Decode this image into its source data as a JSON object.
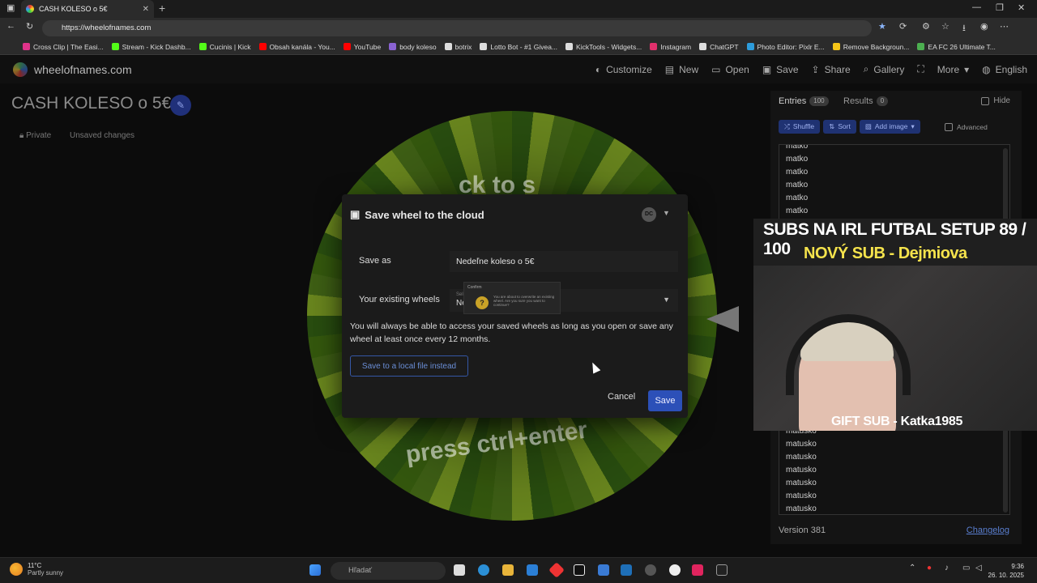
{
  "browser": {
    "tab_title": "CASH KOLESO o 5€",
    "url": "https://wheelofnames.com",
    "bookmarks": [
      {
        "label": "Cross Clip | The Easi...",
        "color": "#e0338a"
      },
      {
        "label": "Stream - Kick Dashb...",
        "color": "#53fc18"
      },
      {
        "label": "Cucinis | Kick",
        "color": "#53fc18"
      },
      {
        "label": "Obsah kanála - You...",
        "color": "#ff0000"
      },
      {
        "label": "YouTube",
        "color": "#ff0000"
      },
      {
        "label": "body koleso",
        "color": "#8a63d2"
      },
      {
        "label": "botrix",
        "color": "#dddddd"
      },
      {
        "label": "Lotto Bot - #1 Givea...",
        "color": "#dddddd"
      },
      {
        "label": "KickTools - Widgets...",
        "color": "#dddddd"
      },
      {
        "label": "Instagram",
        "color": "#e1306c"
      },
      {
        "label": "ChatGPT",
        "color": "#dddddd"
      },
      {
        "label": "Photo Editor: Pixlr E...",
        "color": "#2d9cdb"
      },
      {
        "label": "Remove Backgroun...",
        "color": "#f5c518"
      },
      {
        "label": "EA FC 26 Ultimate T...",
        "color": "#4caf50"
      }
    ]
  },
  "site": {
    "logo": "wheelofnames.com",
    "nav": [
      "Customize",
      "New",
      "Open",
      "Save",
      "Share",
      "Gallery",
      "More",
      "English"
    ]
  },
  "page": {
    "wheel_title": "CASH KOLESO o 5€",
    "privacy": "Private",
    "status": "Unsaved changes",
    "wheel_text_bottom": "press ctrl+enter",
    "wheel_text_top": "ck to s"
  },
  "panel": {
    "tab_entries": "Entries",
    "entries_count": "100",
    "tab_results": "Results",
    "results_count": "0",
    "hide": "Hide",
    "shuffle": "Shuffle",
    "sort": "Sort",
    "add_image": "Add image",
    "advanced": "Advanced",
    "entries_top": [
      "matko",
      "matko",
      "matko",
      "matko",
      "matko",
      "matko"
    ],
    "entries_bottom": [
      "matusko",
      "matusko",
      "matusko",
      "matusko",
      "matusko",
      "matusko",
      "matusko"
    ],
    "version": "Version 381",
    "changelog": "Changelog"
  },
  "dialog": {
    "title": "Save wheel to the cloud",
    "avatar": "DC",
    "save_as_label": "Save as",
    "save_as_value": "Nedeľne koleso o 5€",
    "existing_label": "Your existing wheels",
    "existing_hint": "Selec",
    "existing_value": "Ned",
    "confirm_title": "Confirm",
    "confirm_msg": "You are about to overwrite an existing wheel. Are you sure you want to continue?",
    "info": "You will always be able to access your saved wheels as long as you open or save any wheel at least once every 12 months.",
    "local_button": "Save to a local file instead",
    "cancel": "Cancel",
    "save": "Save"
  },
  "overlay": {
    "title": "SUBS NA IRL FUTBAL SETUP  89 / 100",
    "new_sub": "NOVÝ SUB - Dejmiova",
    "gift_sub": "GIFT SUB - Katka1985",
    "subs_current": 89,
    "subs_goal": 100
  },
  "taskbar": {
    "temp": "11°C",
    "weather": "Partly sunny",
    "search": "Hľadať",
    "time": "9:36",
    "date": "26. 10. 2025"
  }
}
